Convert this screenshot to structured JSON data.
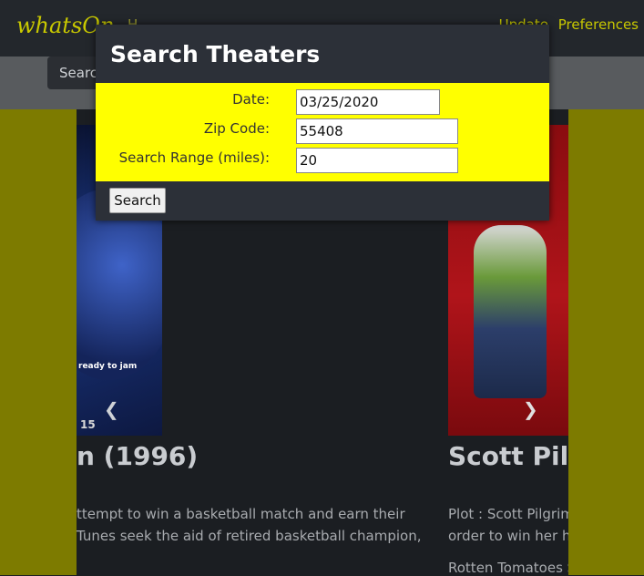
{
  "navbar": {
    "brand": "whatsOn",
    "left_link": "H",
    "right_links": [
      "Update",
      "Preferences"
    ]
  },
  "subbar": {
    "search_label": "Search"
  },
  "posters": {
    "left": {
      "tagline": "ready to jam",
      "number": "15"
    },
    "right": {}
  },
  "movies": {
    "left": {
      "title": "n (1996)",
      "plot_line1": "ttempt to win a basketball match and earn their",
      "plot_line2": " Tunes seek the aid of retired basketball champion,"
    },
    "right": {
      "title": "Scott Pilgrim",
      "plot_line1": "Plot : Scott Pilgrim",
      "plot_line2": "order to win her he",
      "rotten": "Rotten Tomatoes S"
    }
  },
  "modal": {
    "title": "Search Theaters",
    "fields": {
      "date": {
        "label": "Date:",
        "value": "03/25/2020"
      },
      "zip": {
        "label": "Zip Code:",
        "value": "55408"
      },
      "range": {
        "label": "Search Range (miles):",
        "value": "20"
      }
    },
    "search_button": "Search"
  },
  "colors": {
    "form_background": "#ffff00",
    "side_columns": "#7d7b00",
    "modal_background": "#2c3038",
    "brand_text": "#c8c800"
  }
}
